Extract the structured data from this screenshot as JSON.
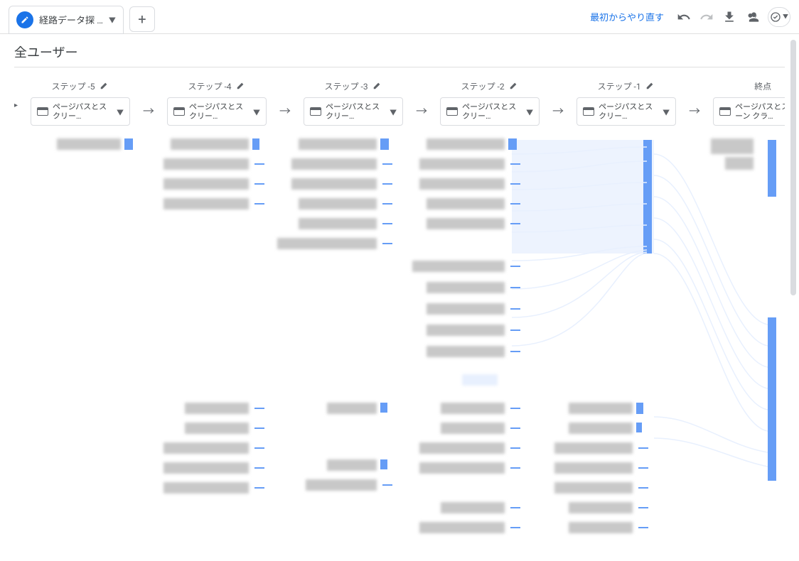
{
  "tab": {
    "title": "経路データ探 …"
  },
  "toolbar": {
    "reset": "最初からやり直す"
  },
  "filter": {
    "title": "全ユーザー"
  },
  "steps": [
    {
      "label": "ステップ -5",
      "dimension": "ページパスとスクリー…",
      "editable": true
    },
    {
      "label": "ステップ -4",
      "dimension": "ページパスとスクリー…",
      "editable": true
    },
    {
      "label": "ステップ -3",
      "dimension": "ページパスとスクリー…",
      "editable": true
    },
    {
      "label": "ステップ -2",
      "dimension": "ページパスとスクリー…",
      "editable": true
    },
    {
      "label": "ステップ -1",
      "dimension": "ページパスとスクリー…",
      "editable": true
    },
    {
      "label": "終点",
      "dimension": "ページパスとスクリーン クラ…",
      "editable": false
    }
  ],
  "colors": {
    "accent": "#1a73e8",
    "bar": "#669df6",
    "flow": "#e8f0fe"
  }
}
